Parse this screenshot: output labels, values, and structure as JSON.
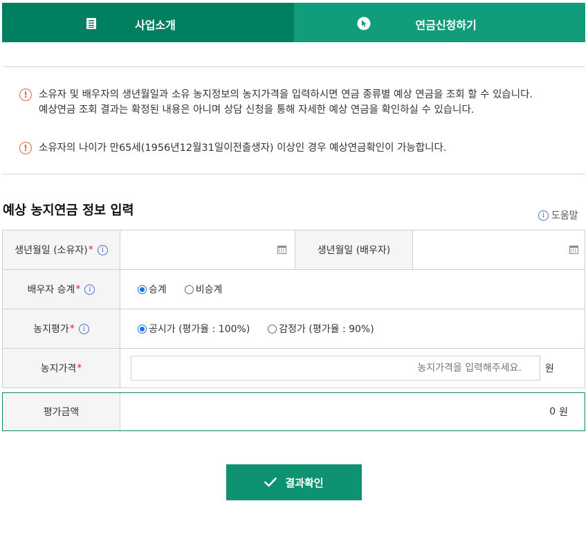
{
  "tabs": [
    {
      "label": "사업소개",
      "icon": "document-list-icon",
      "active": true
    },
    {
      "label": "연금신청하기",
      "icon": "cursor-click-icon",
      "active": false
    }
  ],
  "notices": [
    {
      "icon": "exclamation-circle-icon",
      "lines": [
        "소유자 및 배우자의 생년월일과 소유 농지정보의 농지가격을 입력하시면 연금 종류별 예상 연금을 조회 할 수 있습니다.",
        "예상연금 조회 결과는 확정된 내용은 아니며 상담 신청을 통해 자세한 예상 연금을 확인하실 수 있습니다."
      ]
    },
    {
      "icon": "exclamation-circle-icon",
      "lines": [
        "소유자의 나이가 만65세(1956년12월31일이전출생자) 이상인 경우 예상연금확인이 가능합니다."
      ]
    }
  ],
  "section": {
    "title": "예상 농지연금 정보 입력",
    "help_label": "도움말"
  },
  "form": {
    "owner_birth_label": "생년월일 (소유자)",
    "spouse_birth_label": "생년월일 (배우자)",
    "spouse_succession_label": "배우자 승계",
    "succession_options": [
      "승계",
      "비승계"
    ],
    "succession_selected": "승계",
    "land_valuation_label": "농지평가",
    "valuation_options": [
      "공시가 (평가율 : 100%)",
      "감정가 (평가율 : 90%)"
    ],
    "valuation_selected": "공시가 (평가율 : 100%)",
    "land_price_label": "농지가격",
    "land_price_placeholder": "농지가격을 입력해주세요.",
    "unit": "원",
    "required_mark": "*",
    "info_glyph": "i"
  },
  "result": {
    "label": "평가금액",
    "value": "0",
    "unit": "원"
  },
  "confirm_button": {
    "label": "결과확인"
  },
  "colors": {
    "primary": "#008060",
    "secondary": "#119d7b",
    "button": "#0f9272",
    "warning": "#e0663a",
    "info": "#4a6fd6",
    "radio": "#1a73e8"
  }
}
